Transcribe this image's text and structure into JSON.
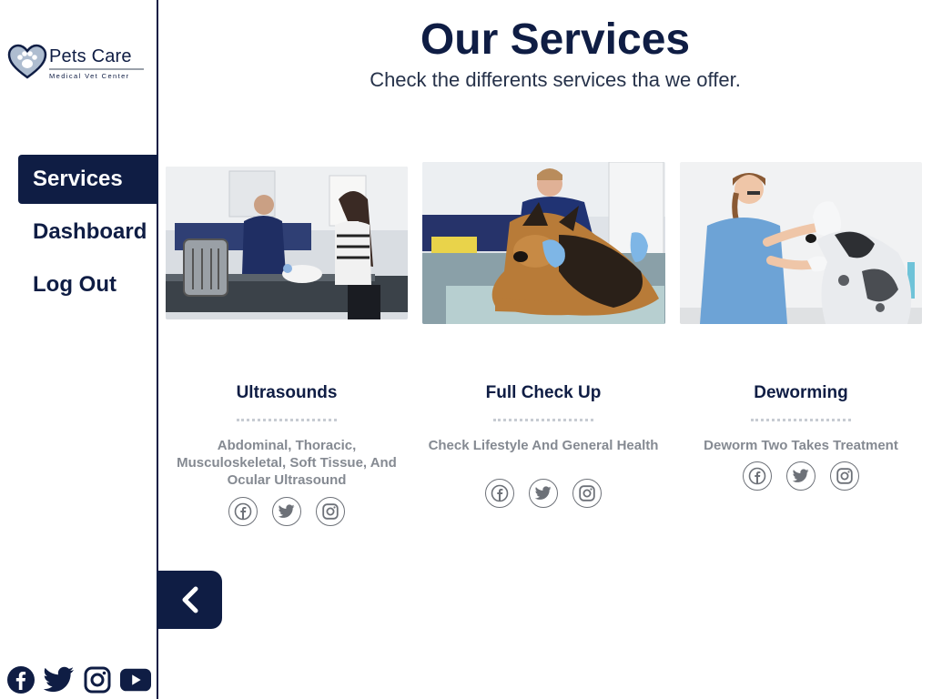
{
  "brand": {
    "name": "Pets Care",
    "tagline": "Medical Vet Center",
    "logo_icon": "heart-paw-icon"
  },
  "nav": {
    "items": [
      {
        "label": "Services",
        "active": true
      },
      {
        "label": "Dashboard",
        "active": false
      },
      {
        "label": "Log Out",
        "active": false
      }
    ]
  },
  "footer_social": [
    "facebook-icon",
    "twitter-icon",
    "instagram-icon",
    "youtube-icon"
  ],
  "collapse_icon": "chevron-left-icon",
  "page": {
    "title": "Our Services",
    "subtitle": "Check the differents services tha we offer."
  },
  "services": [
    {
      "title": "Ultrasounds",
      "description": "Abdominal, Thoracic, Musculoskeletal, Soft Tissue, And Ocular Ultrasound",
      "image_alt": "vet with pet carrier and owner",
      "social": [
        "facebook-icon",
        "twitter-icon",
        "instagram-icon"
      ]
    },
    {
      "title": "Full Check Up",
      "description": "Check Lifestyle And General Health",
      "image_alt": "vet examining german shepherd",
      "social": [
        "facebook-icon",
        "twitter-icon",
        "instagram-icon"
      ]
    },
    {
      "title": "Deworming",
      "description": "Deworm Two Takes Treatment",
      "image_alt": "vet holding dog paw",
      "social": [
        "facebook-icon",
        "twitter-icon",
        "instagram-icon"
      ]
    }
  ],
  "colors": {
    "primary": "#0f1d44",
    "muted_text": "#858a92",
    "background": "#ffffff"
  }
}
